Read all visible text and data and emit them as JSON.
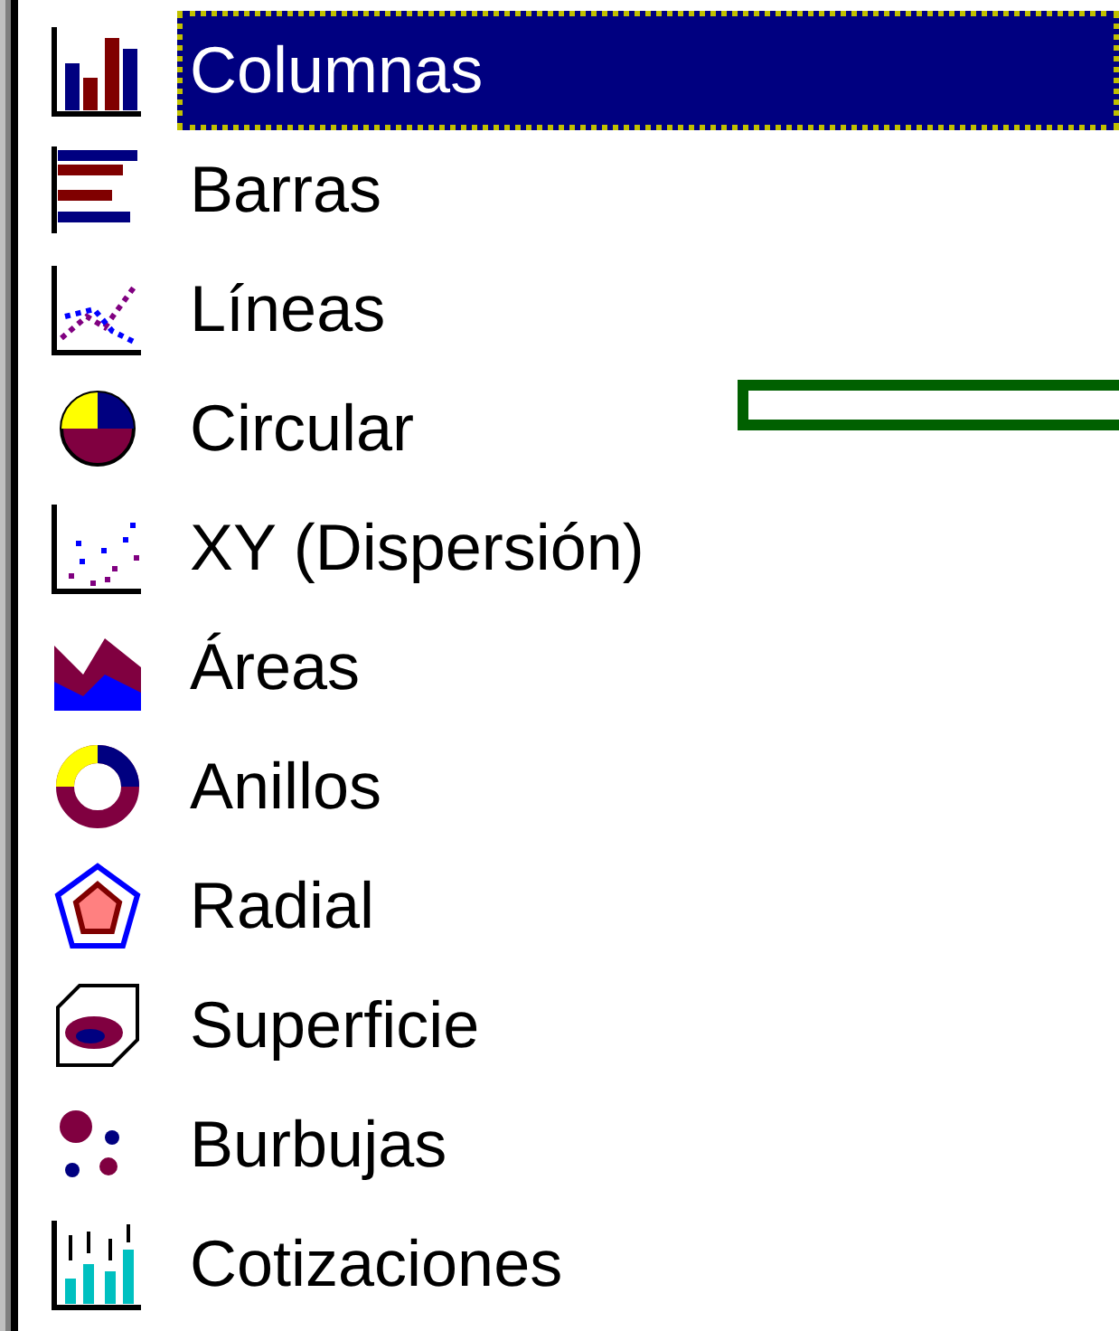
{
  "chart_types": [
    {
      "label": "Columnas",
      "kind": "columns",
      "selected": true
    },
    {
      "label": "Barras",
      "kind": "bars",
      "selected": false
    },
    {
      "label": "Líneas",
      "kind": "lines",
      "selected": false
    },
    {
      "label": "Circular",
      "kind": "pie",
      "selected": false
    },
    {
      "label": "XY (Dispersión)",
      "kind": "scatter",
      "selected": false
    },
    {
      "label": "Áreas",
      "kind": "area",
      "selected": false
    },
    {
      "label": "Anillos",
      "kind": "doughnut",
      "selected": false
    },
    {
      "label": "Radial",
      "kind": "radar",
      "selected": false
    },
    {
      "label": "Superficie",
      "kind": "surface",
      "selected": false
    },
    {
      "label": "Burbujas",
      "kind": "bubble",
      "selected": false
    },
    {
      "label": "Cotizaciones",
      "kind": "stock",
      "selected": false
    }
  ]
}
